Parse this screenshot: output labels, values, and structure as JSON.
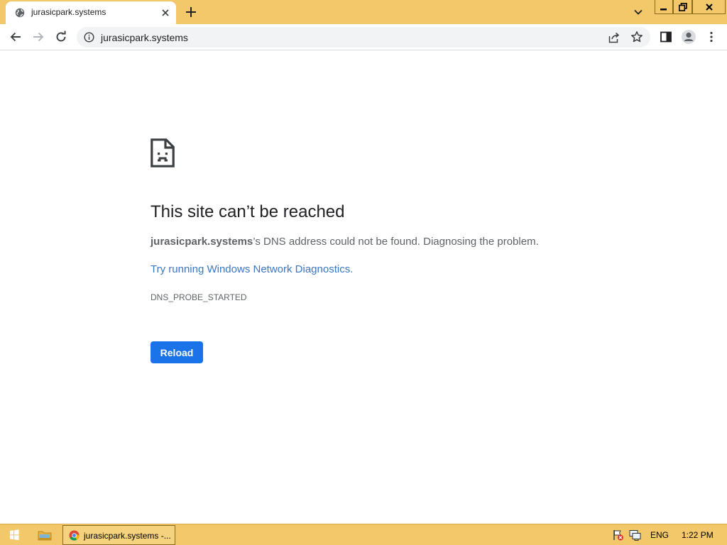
{
  "browser": {
    "tab": {
      "title": "jurasicpark.systems"
    },
    "omnibox": {
      "url": "jurasicpark.systems"
    }
  },
  "icons": {
    "tab": [
      "globe-icon",
      "close-icon",
      "plus-icon",
      "chevron-down-icon"
    ],
    "window": [
      "minimize-icon",
      "restore-icon",
      "close-icon"
    ],
    "toolbar": [
      "back-arrow-icon",
      "forward-arrow-icon",
      "reload-icon",
      "info-icon",
      "share-icon",
      "star-icon",
      "side-panel-icon",
      "profile-icon",
      "more-vertical-icon"
    ],
    "page": [
      "sad-document-icon"
    ],
    "taskbar": [
      "windows-logo-icon",
      "folder-icon",
      "chrome-icon",
      "flag-warning-icon",
      "network-icon"
    ]
  },
  "error_page": {
    "title": "This site can’t be reached",
    "host": "jurasicpark.systems",
    "description": "’s DNS address could not be found. Diagnosing the problem.",
    "link": "Try running Windows Network Diagnostics.",
    "error_code": "DNS_PROBE_STARTED",
    "reload_label": "Reload"
  },
  "taskbar": {
    "task_label": "jurasicpark.systems -...",
    "language": "ENG",
    "clock": "1:22 PM"
  },
  "colors": {
    "frame": "#f2c86a",
    "accent": "#1a73e8",
    "link": "#3a76c2"
  }
}
